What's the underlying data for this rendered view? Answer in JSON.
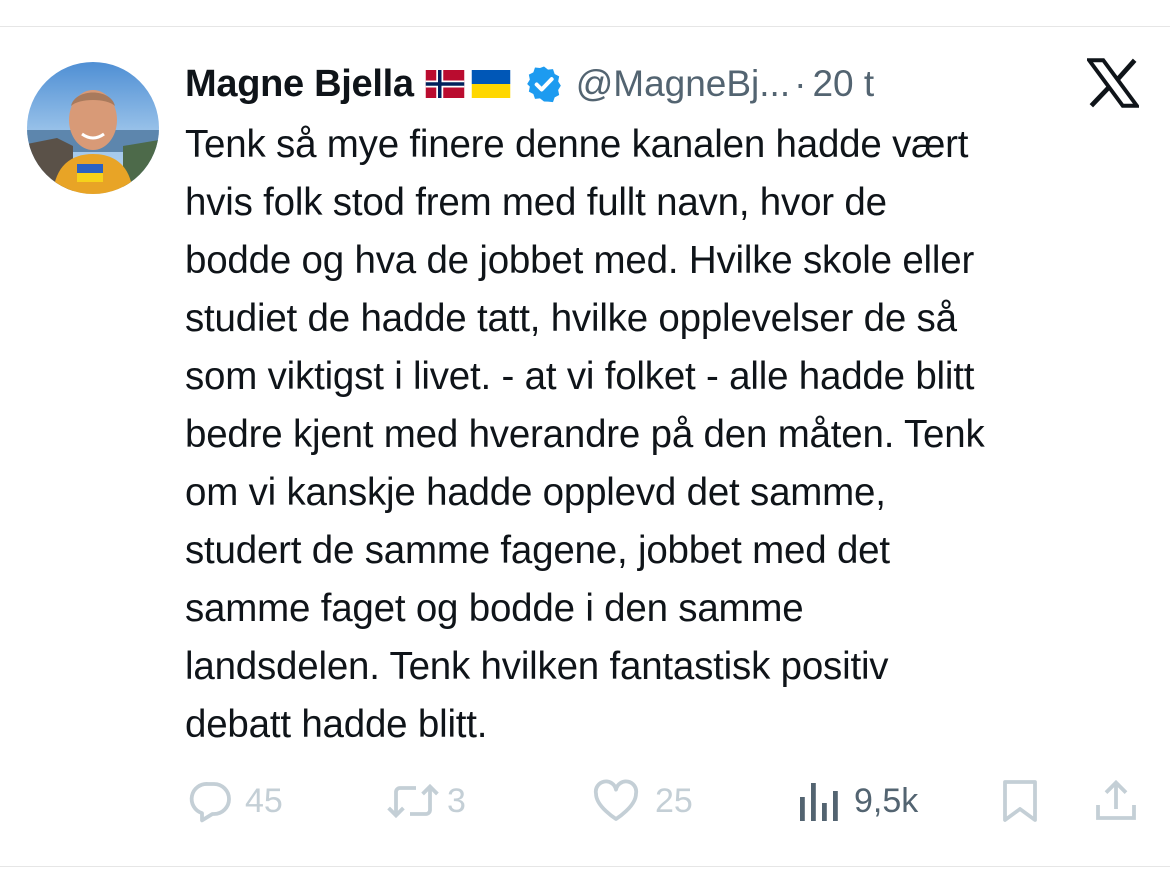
{
  "tweet": {
    "author_name": "Magne Bjella",
    "flags": [
      "norway-flag",
      "ukraine-flag"
    ],
    "handle": "@MagneBj...",
    "separator": "·",
    "time": "20 t",
    "text_lines": [
      "Tenk så mye finere denne kanalen hadde vært",
      "hvis folk stod frem med fullt navn, hvor de",
      "bodde og hva de jobbet med. Hvilke skole eller",
      "studiet de hadde tatt, hvilke opplevelser de så",
      "som viktigst i livet. - at vi folket - alle hadde blitt",
      "bedre kjent med hverandre på den måten. Tenk",
      "om vi kanskje hadde opplevd det samme,",
      "studert de samme fagene, jobbet med det",
      "samme faget og bodde i den samme",
      "landsdelen. Tenk hvilken fantastisk positiv",
      "debatt hadde blitt."
    ]
  },
  "actions": {
    "replies": "45",
    "reposts": "3",
    "likes": "25",
    "views": "9,5k"
  },
  "colors": {
    "text": "#0f1419",
    "secondary": "#536471",
    "muted_icon": "#c4cfd6",
    "verified": "#1d9bf0"
  },
  "icons": [
    "avatar",
    "norway-flag-icon",
    "ukraine-flag-icon",
    "verified-badge-icon",
    "x-logo-icon",
    "reply-icon",
    "repost-icon",
    "like-icon",
    "views-icon",
    "bookmark-icon",
    "share-icon"
  ]
}
